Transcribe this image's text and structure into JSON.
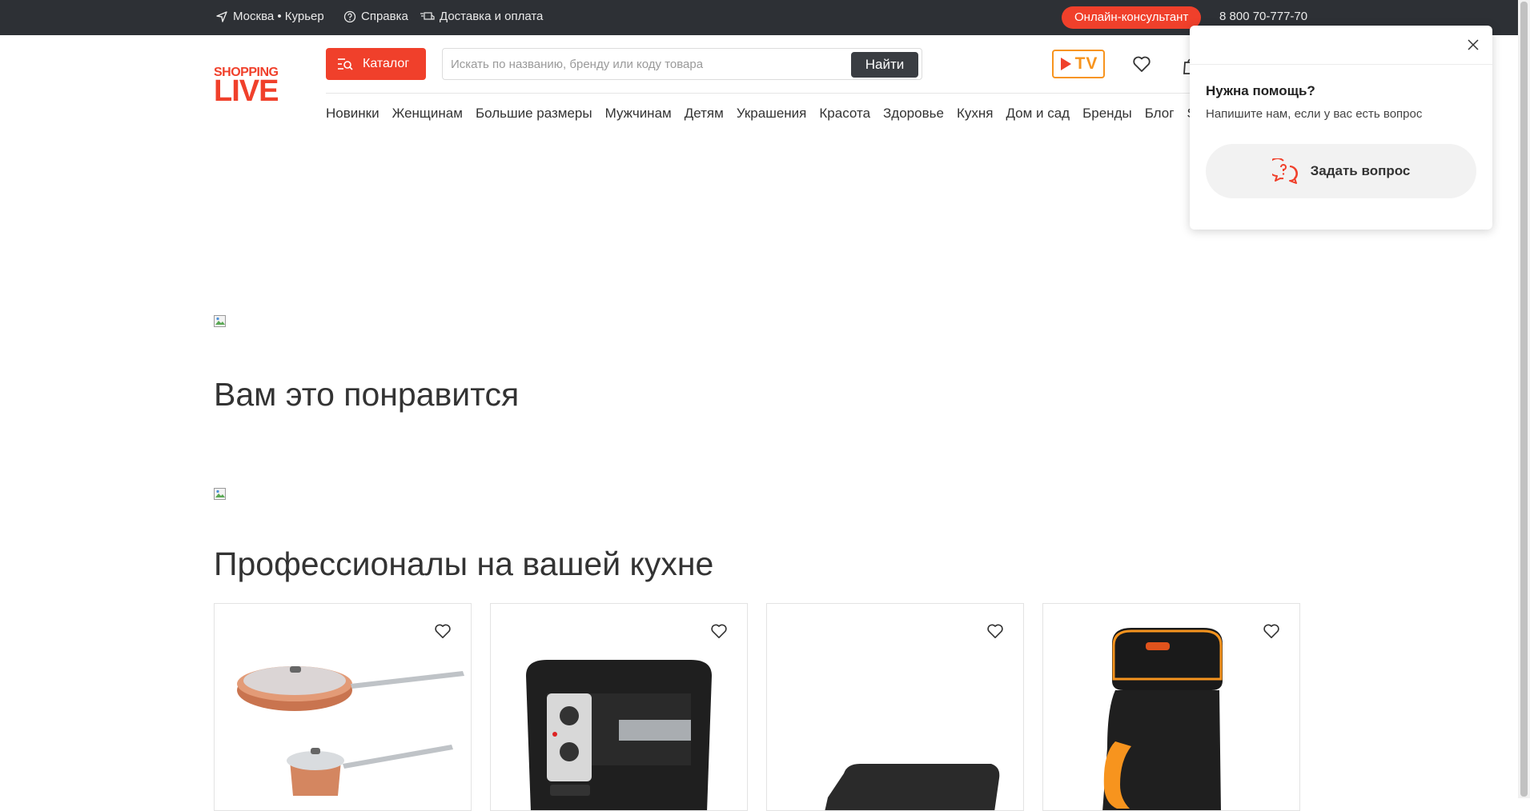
{
  "topbar": {
    "location": "Москва • Курьер",
    "help": "Справка",
    "delivery": "Доставка и оплата",
    "consultant": "Онлайн-консультант",
    "phone": "8 800 70-777-70"
  },
  "header": {
    "logo_top": "SHOPPING",
    "logo_bottom": "LIVE",
    "catalog_label": "Каталог",
    "search_placeholder": "Искать по названию, бренду или коду товара",
    "search_button": "Найти",
    "tv_label": "TV"
  },
  "nav": {
    "items": [
      "Новинки",
      "Женщинам",
      "Большие размеры",
      "Мужчинам",
      "Детям",
      "Украшения",
      "Красота",
      "Здоровье",
      "Кухня",
      "Дом и сад",
      "Бренды",
      "Блог",
      "S"
    ]
  },
  "sections": {
    "recommend_title": "Вам это понравится",
    "kitchen_title": "Профессионалы на вашей кухне"
  },
  "products": [
    {
      "image": "copper-cookware-set"
    },
    {
      "image": "air-fryer-brayer"
    },
    {
      "image": "black-device"
    },
    {
      "image": "turkish-coffee-maker-brayer"
    }
  ],
  "popup": {
    "title": "Нужна помощь?",
    "subtitle": "Напишите нам, если у вас есть вопрос",
    "ask_button": "Задать вопрос"
  },
  "colors": {
    "accent": "#f0402b",
    "tv": "#f7941e",
    "topbar": "#2d3035"
  }
}
